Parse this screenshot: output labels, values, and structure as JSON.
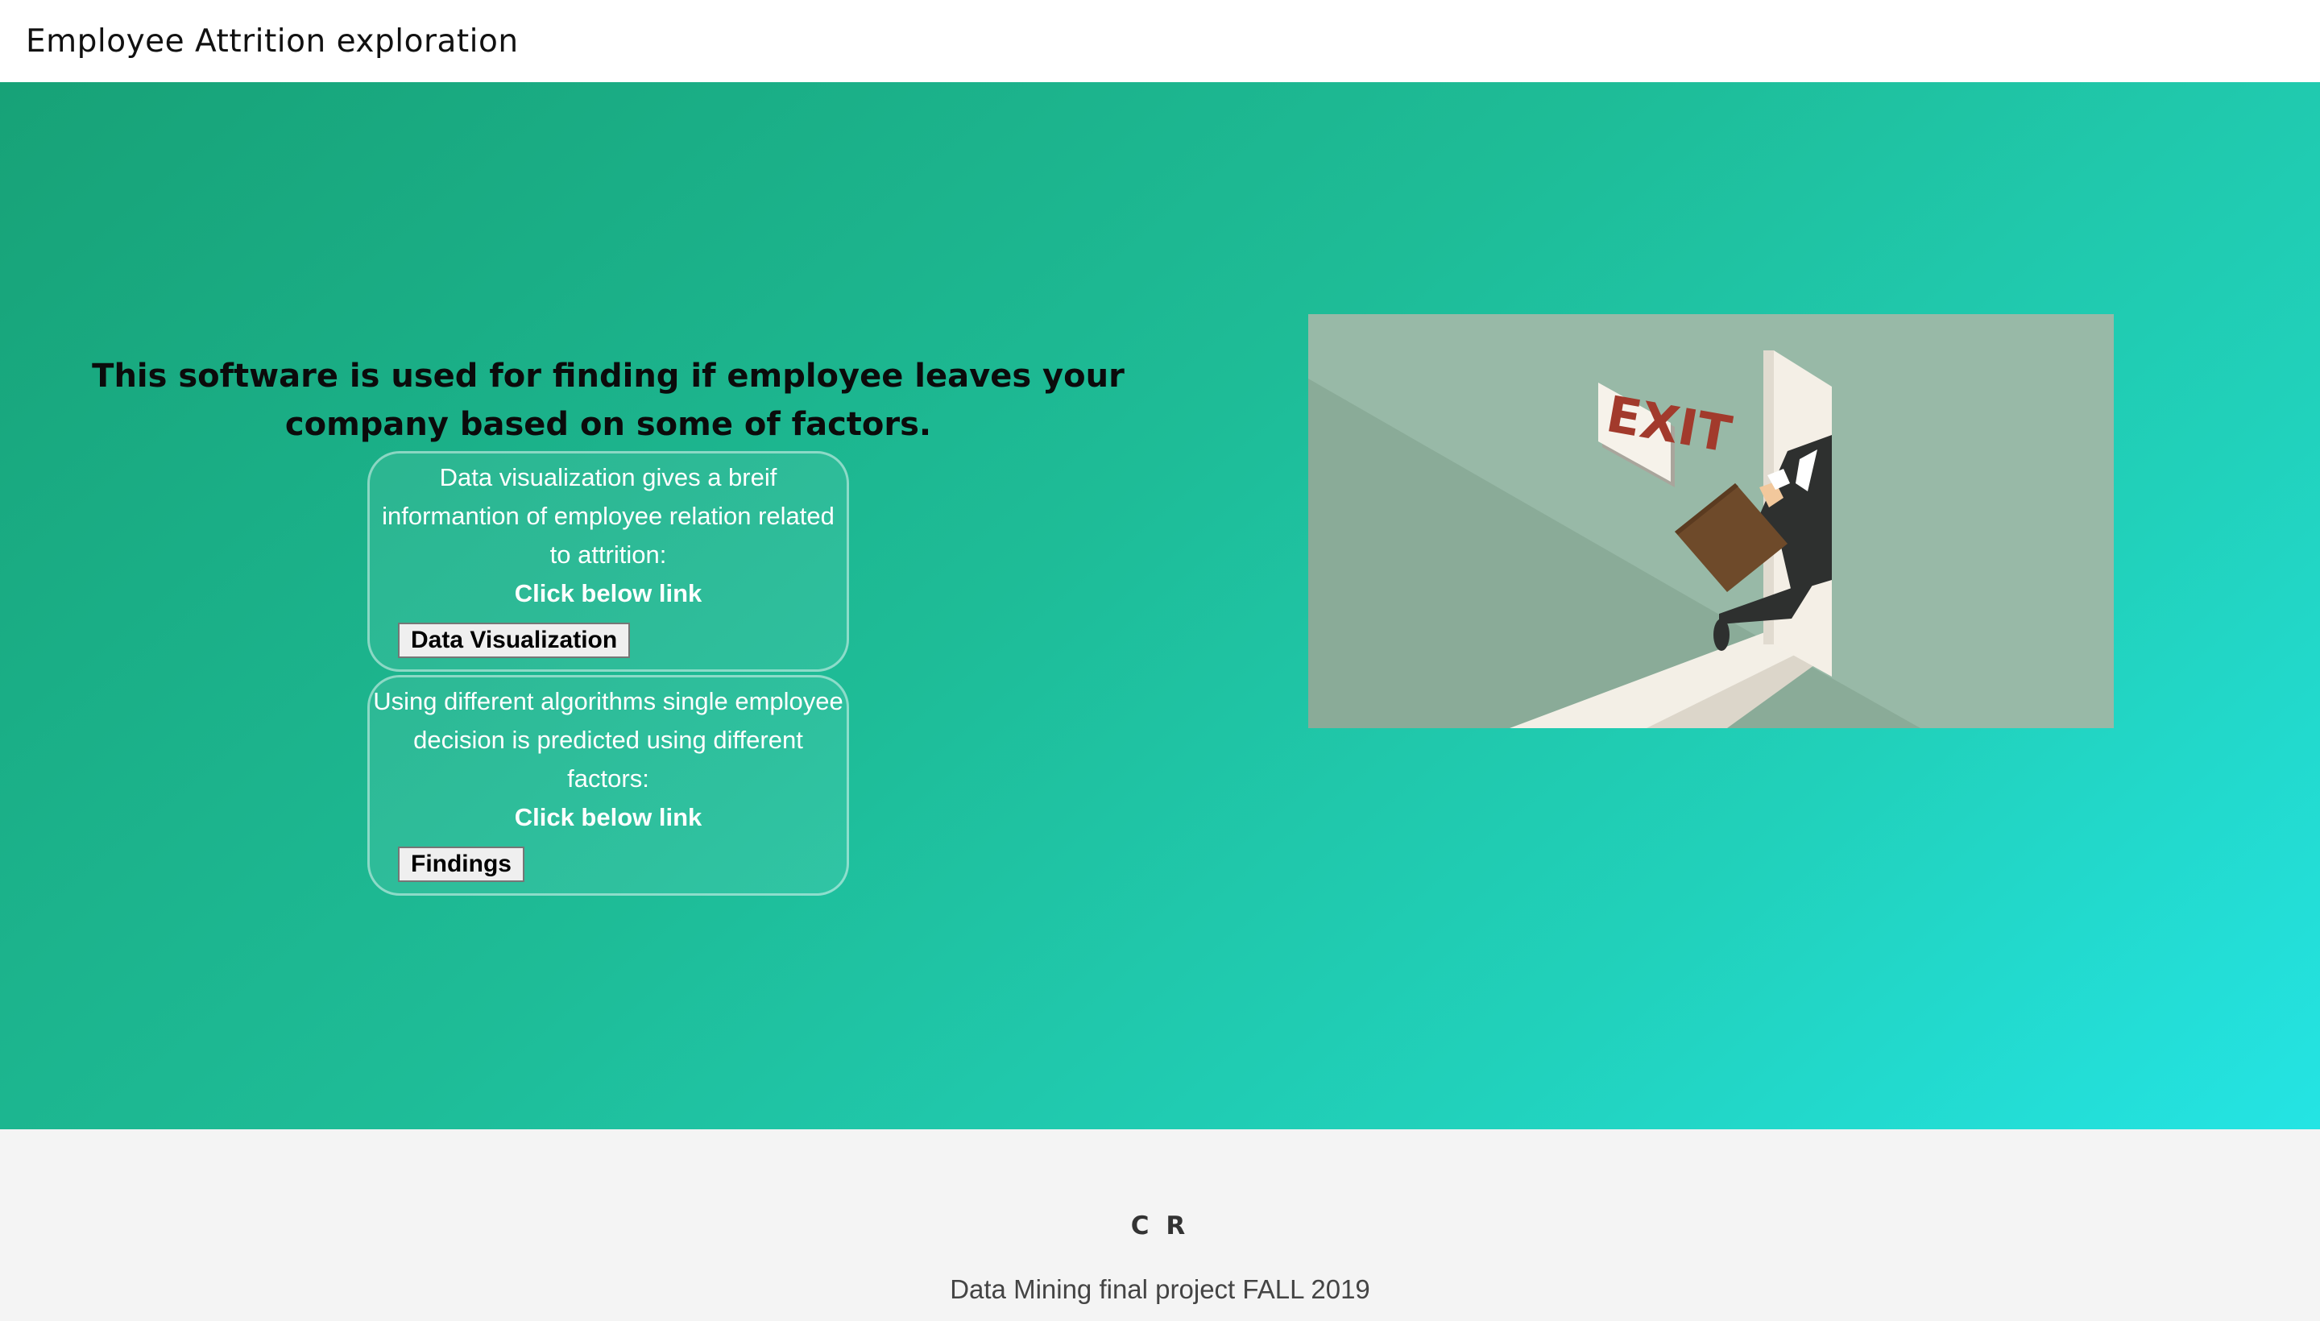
{
  "header": {
    "title": "Employee Attrition exploration"
  },
  "hero": {
    "tagline": "This software is used for finding if employee leaves your company based on some of factors.",
    "cards": [
      {
        "description": "Data visualization gives a breif informantion of employee relation related to attrition:",
        "cta_text": "Click below link",
        "button_label": "Data Visualization"
      },
      {
        "description": "Using different algorithms single employee decision is predicted using different factors:",
        "cta_text": "Click below link",
        "button_label": "Findings"
      }
    ],
    "illustration": {
      "sign_text": "EXIT",
      "icon": "employee-exit-illustration"
    }
  },
  "footer": {
    "initials": "C R",
    "note": "Data Mining final project FALL 2019"
  },
  "colors": {
    "gradient_start": "#17a277",
    "gradient_end": "#24e4e4",
    "footer_bg": "#f4f4f4"
  }
}
